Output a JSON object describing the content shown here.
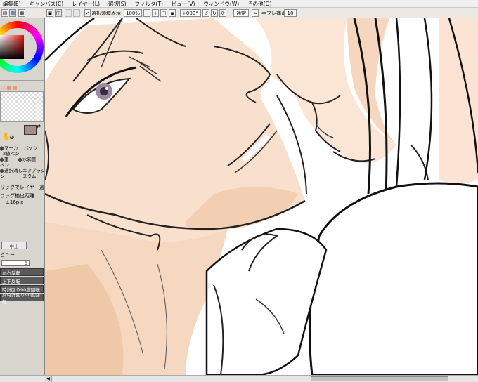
{
  "menu": {
    "items": [
      "編集(E)",
      "キャンバス(C)",
      "レイヤー(L)",
      "選択(S)",
      "フィルタ(T)",
      "ビュー(V)",
      "ウィンドウ(W)",
      "その他(O)"
    ]
  },
  "toolbar": {
    "selection_display_label": "選択領域表示",
    "zoom_value": "100%",
    "rotation_value": "+000°",
    "blend_mode": "通常",
    "stabilizer_label": "手ブレ補正",
    "stabilizer_value": "10"
  },
  "tools": {
    "marker": "マーカ",
    "bucket": "バケツ",
    "binary_pen": "2値ペン",
    "brush": "筆",
    "watercolor": "水彩筆",
    "pen": "ペン",
    "select_eraser": "選択消し",
    "airbrush": "エアブラシ",
    "row4a": "ン",
    "row4b": "スタム"
  },
  "options": {
    "layer_select": "リックでレイヤー選択",
    "drag_threshold": "ラッグ検出距離",
    "drag_threshold_value": "±16pix",
    "stop_label": "中止",
    "preview_label": "ビュー",
    "preview_value": "0"
  },
  "view_buttons": [
    "左右反転",
    "上下反転",
    "時計回り90度回転",
    "反時計回り90度回転"
  ],
  "colors": {
    "current": "#a88c88",
    "skin": "#f7dcc6",
    "shadow": "#eab894"
  }
}
